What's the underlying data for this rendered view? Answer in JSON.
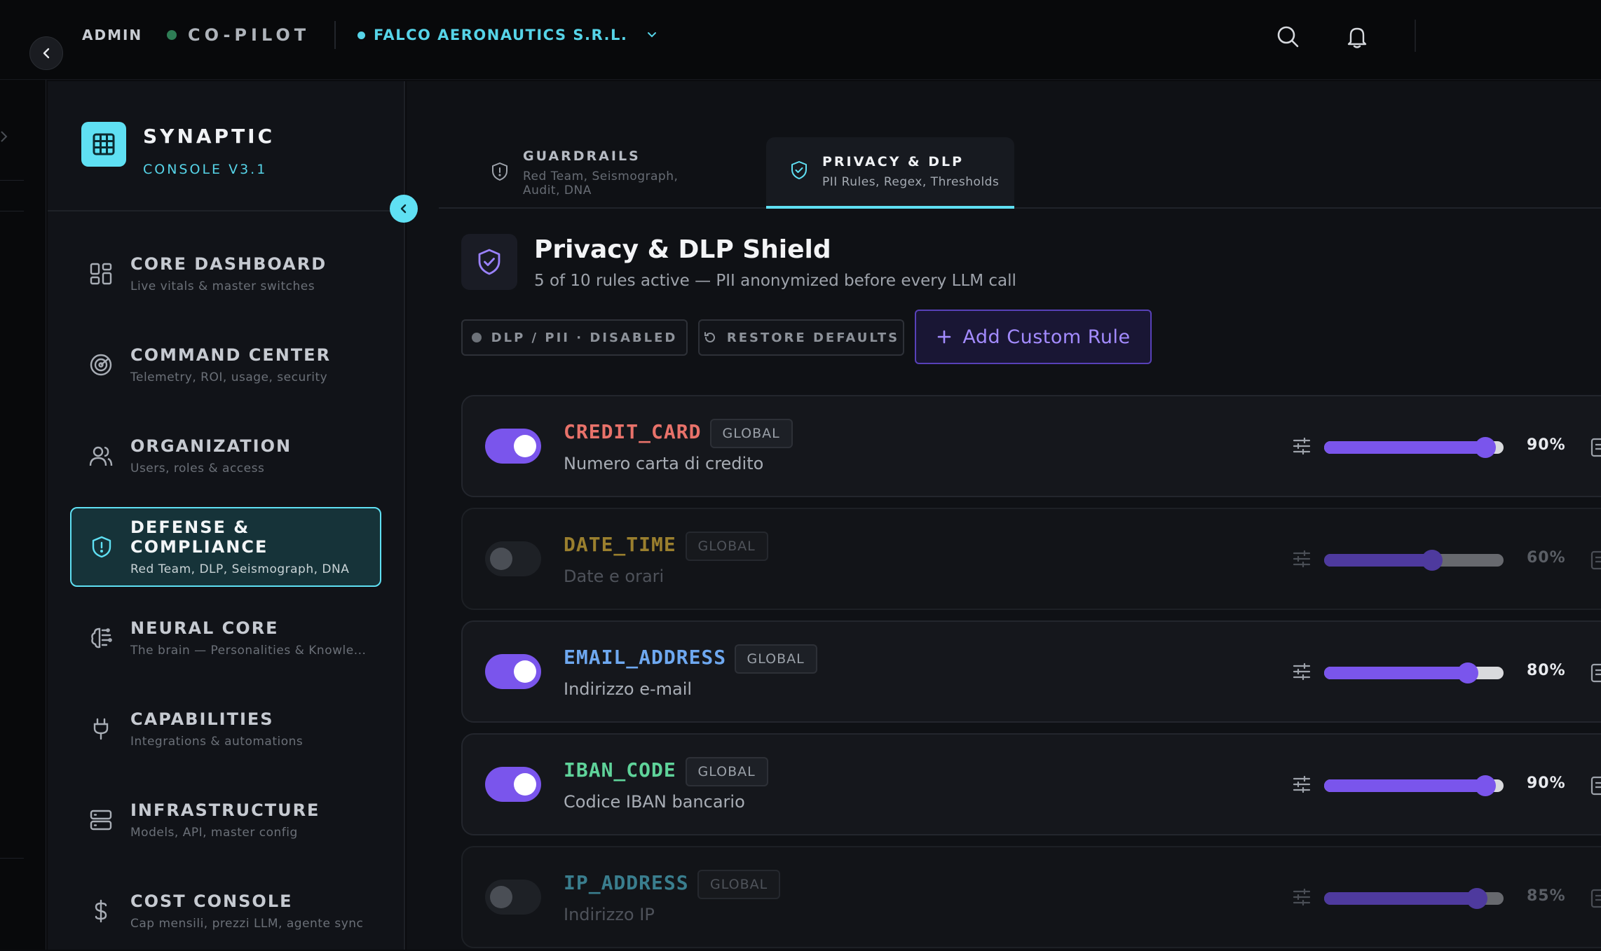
{
  "topbar": {
    "admin_label": "ADMIN",
    "copilot_label": "CO-PILOT",
    "org_name": "FALCO AERONAUTICS S.R.L.",
    "icons": [
      "chevron-left-icon",
      "chevron-down-icon",
      "search-icon",
      "bell-icon"
    ]
  },
  "brand": {
    "name": "SYNAPTIC",
    "version": "CONSOLE V3.1"
  },
  "sidebar": {
    "items": [
      {
        "title": "CORE DASHBOARD",
        "subtitle": "Live vitals & master switches",
        "icon": "dashboard-icon"
      },
      {
        "title": "COMMAND CENTER",
        "subtitle": "Telemetry, ROI, usage, security",
        "icon": "radar-icon"
      },
      {
        "title": "ORGANIZATION",
        "subtitle": "Users, roles & access",
        "icon": "users-icon"
      },
      {
        "title": "DEFENSE & COMPLIANCE",
        "subtitle": "Red Team, DLP, Seismograph, DNA",
        "icon": "shield-icon",
        "active": true
      },
      {
        "title": "NEURAL CORE",
        "subtitle": "The brain — Personalities & Knowle...",
        "icon": "brain-icon"
      },
      {
        "title": "CAPABILITIES",
        "subtitle": "Integrations & automations",
        "icon": "plug-icon"
      },
      {
        "title": "INFRASTRUCTURE",
        "subtitle": "Models, API, master config",
        "icon": "server-icon"
      },
      {
        "title": "COST CONSOLE",
        "subtitle": "Cap mensili, prezzi LLM, agente sync",
        "icon": "dollar-icon"
      }
    ]
  },
  "tabs": [
    {
      "title": "GUARDRAILS",
      "subtitle": "Red Team, Seismograph, Audit, DNA"
    },
    {
      "title": "PRIVACY & DLP",
      "subtitle": "PII Rules, Regex, Thresholds",
      "active": true
    }
  ],
  "header": {
    "title": "Privacy & DLP Shield",
    "subtitle": "5 of 10 rules active — PII anonymized before every LLM call"
  },
  "actions": {
    "dlp_status": "DLP / PII · DISABLED",
    "restore": "RESTORE DEFAULTS",
    "add_rule": "Add Custom Rule"
  },
  "rules": [
    {
      "name": "CREDIT_CARD",
      "scope": "GLOBAL",
      "description": "Numero carta di credito",
      "enabled": true,
      "threshold": 90,
      "threshold_label": "90%",
      "color": "#e8726a"
    },
    {
      "name": "DATE_TIME",
      "scope": "GLOBAL",
      "description": "Date e orari",
      "enabled": false,
      "threshold": 60,
      "threshold_label": "60%",
      "color": "#9a7f2e"
    },
    {
      "name": "EMAIL_ADDRESS",
      "scope": "GLOBAL",
      "description": "Indirizzo e-mail",
      "enabled": true,
      "threshold": 80,
      "threshold_label": "80%",
      "color": "#6ea8f0"
    },
    {
      "name": "IBAN_CODE",
      "scope": "GLOBAL",
      "description": "Codice IBAN bancario",
      "enabled": true,
      "threshold": 90,
      "threshold_label": "90%",
      "color": "#5fd39a"
    },
    {
      "name": "IP_ADDRESS",
      "scope": "GLOBAL",
      "description": "Indirizzo IP",
      "enabled": false,
      "threshold": 85,
      "threshold_label": "85%",
      "color": "#3a7e8e"
    }
  ],
  "colors": {
    "accent": "#5fe0f3",
    "purple": "#7a55ec",
    "background": "#0f1115"
  }
}
